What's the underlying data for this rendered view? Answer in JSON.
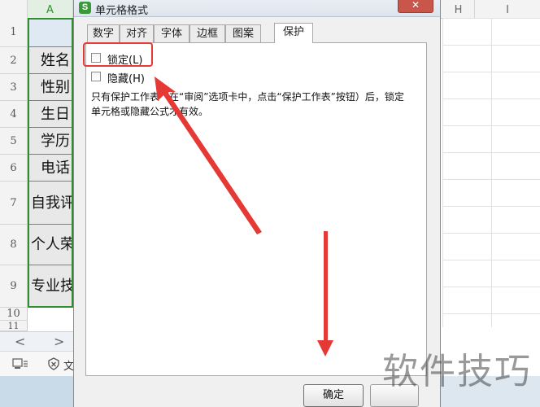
{
  "spreadsheet": {
    "column_headers": [
      "A",
      "H",
      "I"
    ],
    "row_numbers": [
      "1",
      "2",
      "3",
      "4",
      "5",
      "6",
      "7",
      "8",
      "9",
      "10",
      "11"
    ],
    "column_a_cells": [
      "",
      "姓名",
      "性别",
      "生日",
      "学历",
      "电话",
      "自我评价",
      "个人荣誉",
      "专业技能"
    ],
    "selection_color": "#2f8f2f",
    "sheet_nav": {
      "prev": "<",
      "next": ">"
    },
    "status_text": "文"
  },
  "dialog": {
    "title": "单元格格式",
    "app_icon": "S",
    "close_label": "✕",
    "tabs": [
      "数字",
      "对齐",
      "字体",
      "边框",
      "图案",
      "保护"
    ],
    "active_tab": "保护",
    "lock_checkbox": {
      "label": "锁定(L)",
      "checked": false
    },
    "hide_checkbox": {
      "label": "隐藏(H)",
      "checked": false
    },
    "hint_text": "只有保护工作表（在“审阅”选项卡中，点击“保护工作表”按钮）后，锁定单元格或隐藏公式才有效。",
    "ok_label": "确定"
  },
  "annotation": {
    "highlight_color": "#e53935"
  },
  "watermark": "软件技巧"
}
